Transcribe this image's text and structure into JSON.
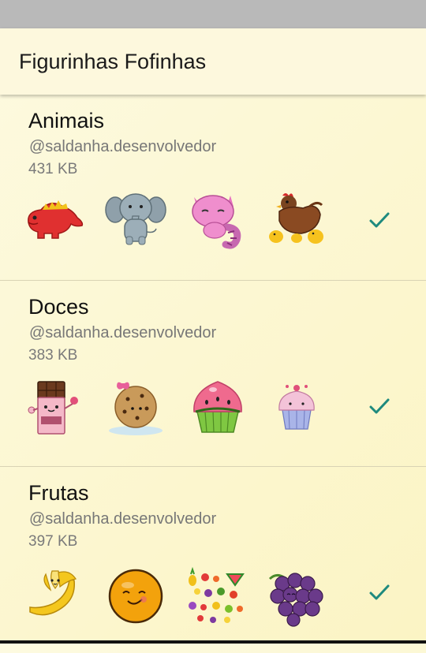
{
  "app": {
    "title": "Figurinhas Fofinhas"
  },
  "packs": [
    {
      "name": "Animais",
      "author": "@saldanha.desenvolvedor",
      "size": "431 KB",
      "stickers": [
        "dinosaur-sticker",
        "elephant-sticker",
        "pink-cat-sticker",
        "hen-chicks-sticker"
      ],
      "added": true
    },
    {
      "name": "Doces",
      "author": "@saldanha.desenvolvedor",
      "size": "383 KB",
      "stickers": [
        "chocolate-bar-sticker",
        "cookie-sticker",
        "watermelon-cupcake-sticker",
        "purple-cupcake-sticker"
      ],
      "added": true
    },
    {
      "name": "Frutas",
      "author": "@saldanha.desenvolvedor",
      "size": "397 KB",
      "stickers": [
        "banana-sticker",
        "orange-sticker",
        "fruit-mix-sticker",
        "grapes-sticker"
      ],
      "added": true
    }
  ],
  "colors": {
    "accent": "#1e8a7e",
    "statusbar": "#b9b9b9",
    "appbar": "#fdf8dd"
  }
}
